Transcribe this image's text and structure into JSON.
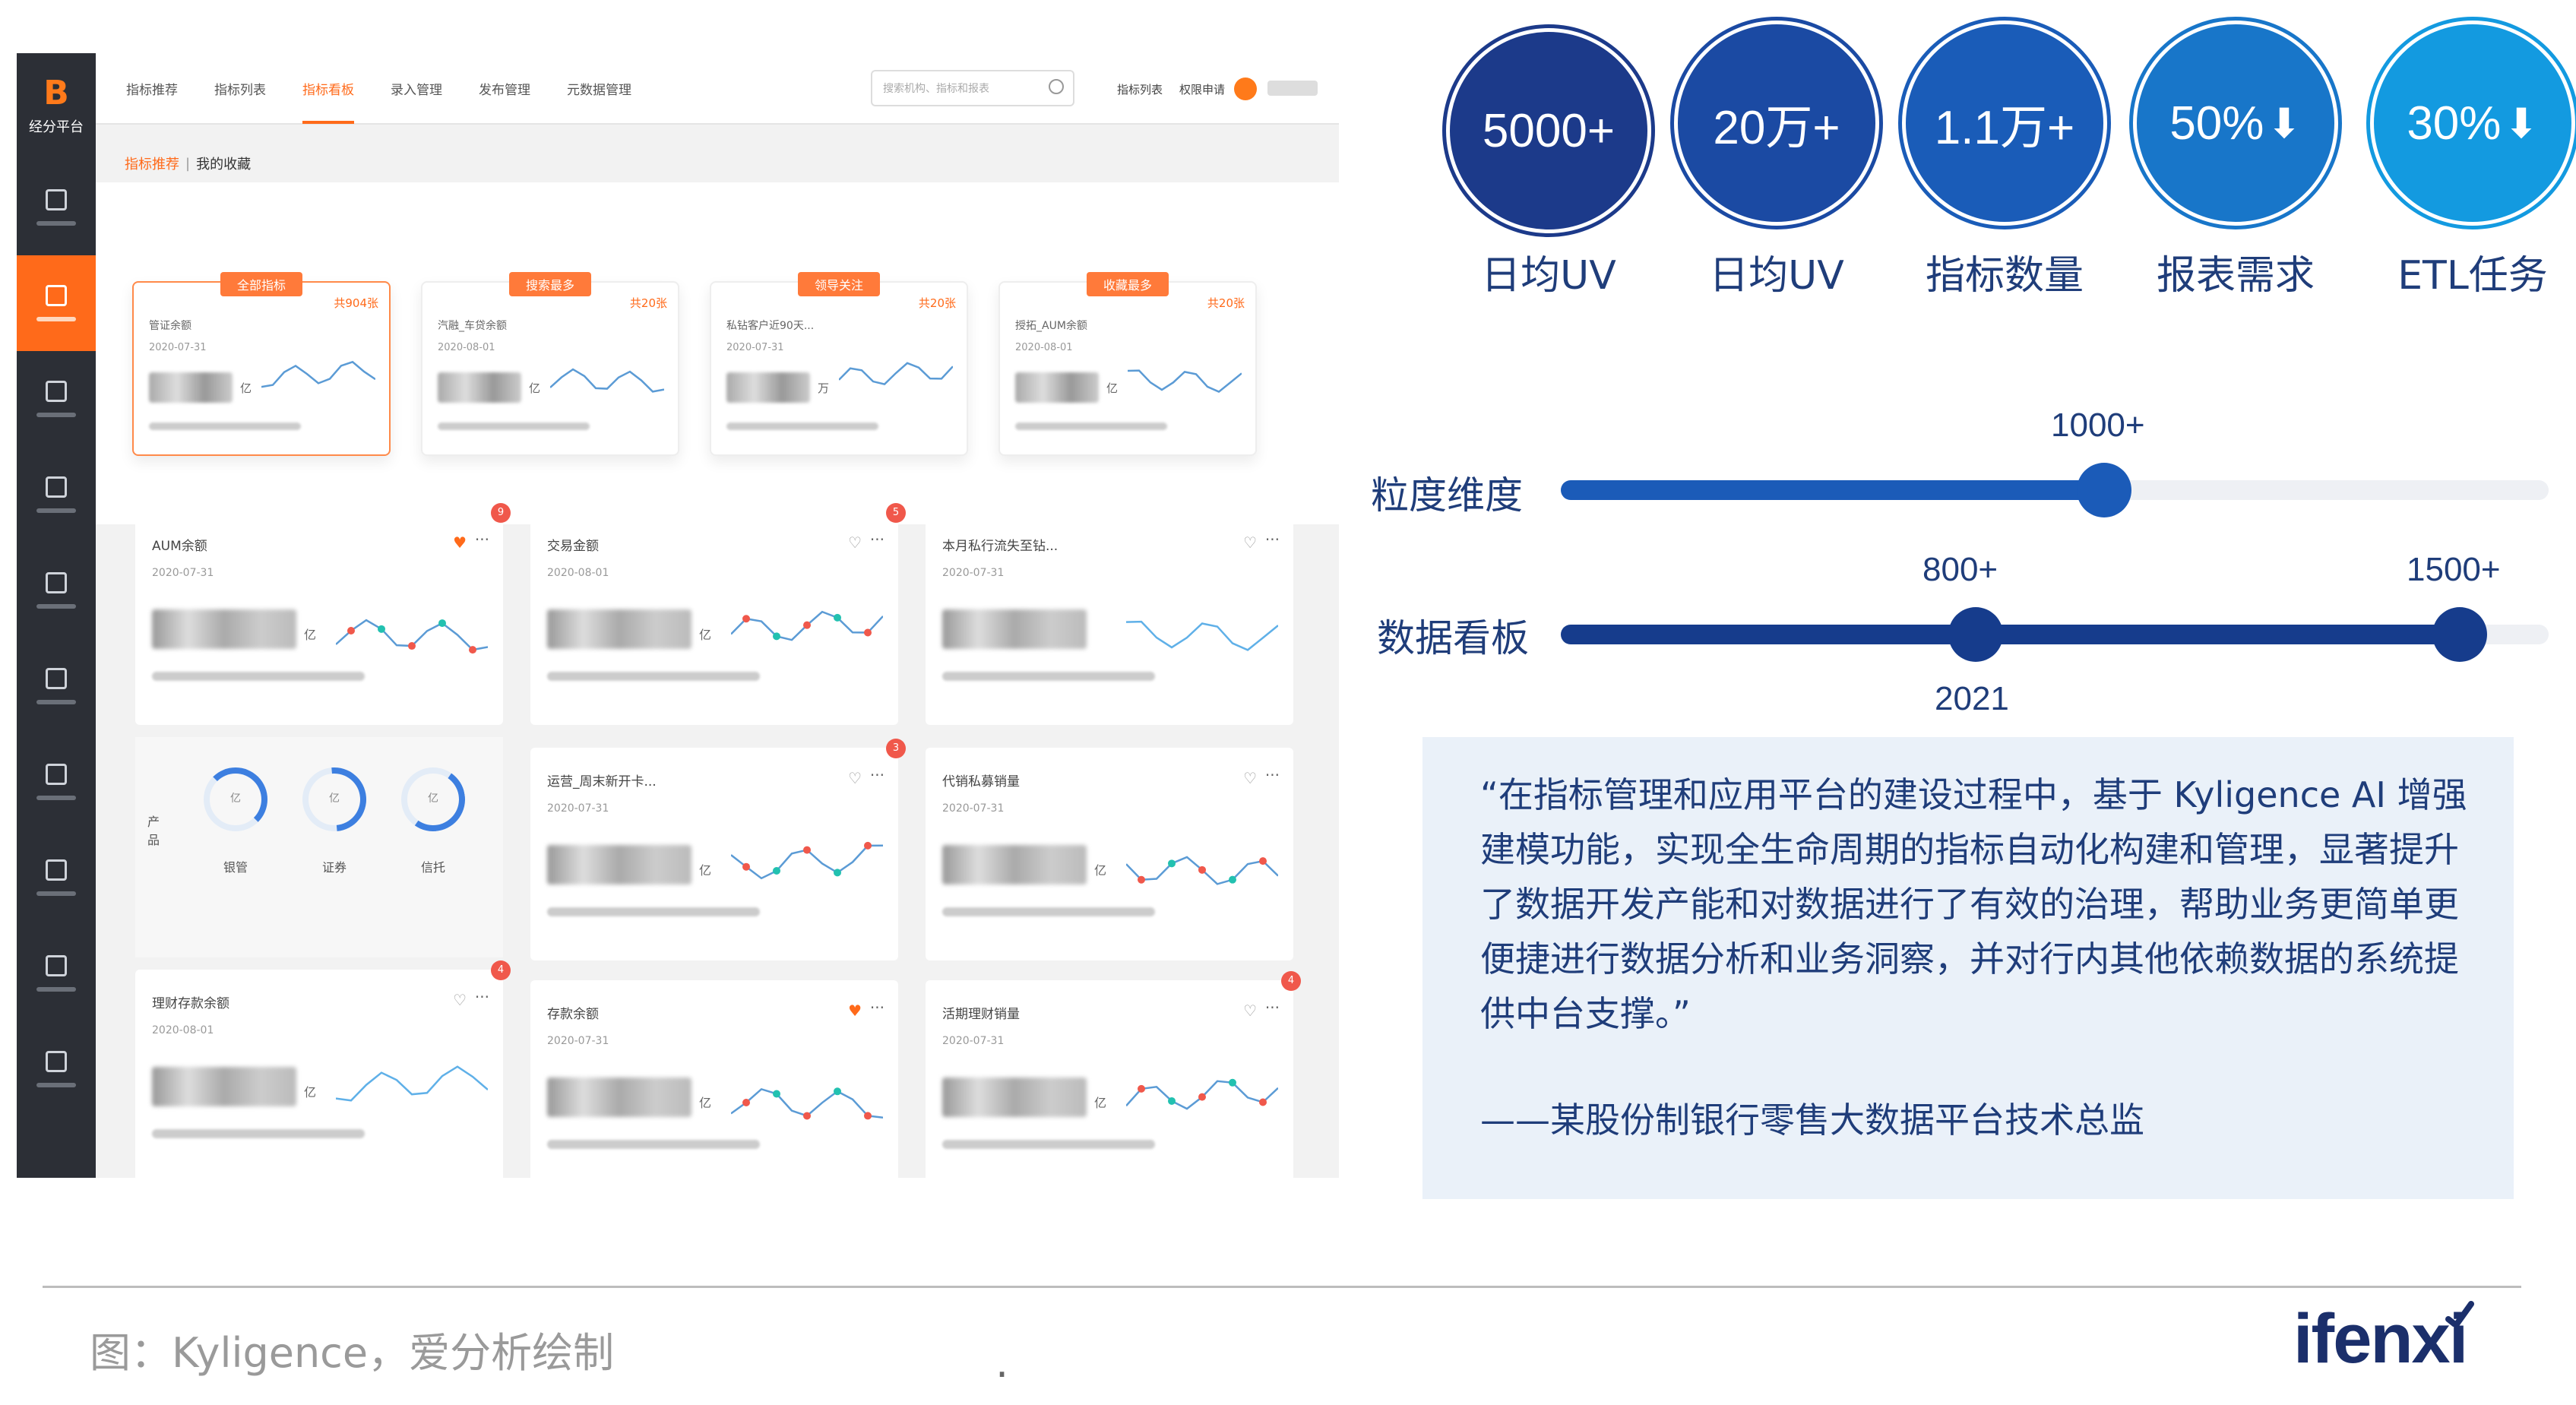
{
  "app": {
    "logo_mark": "B",
    "logo_name": "经分平台",
    "nav_tabs": [
      "指标推荐",
      "指标列表",
      "指标看板",
      "录入管理",
      "发布管理",
      "元数据管理"
    ],
    "active_tab": 2,
    "search_placeholder": "搜索机构、指标和报表",
    "top_links": [
      "指标列表",
      "权限申请"
    ],
    "breadcrumb": {
      "current": "指标推荐",
      "sep": "|",
      "fav": "我的收藏"
    },
    "hot_cards": [
      {
        "tag": "全部指标",
        "count": "共904张",
        "name": "管证余额",
        "date": "2020-07-31",
        "unit": "亿",
        "color": "#5b9bd5"
      },
      {
        "tag": "搜索最多",
        "count": "共20张",
        "name": "汽融_车贷余额",
        "date": "2020-08-01",
        "unit": "亿",
        "color": "#5b9bd5"
      },
      {
        "tag": "领导关注",
        "count": "共20张",
        "name": "私钻客户近90天...",
        "date": "2020-07-31",
        "unit": "万",
        "color": "#5b9bd5"
      },
      {
        "tag": "收藏最多",
        "count": "共20张",
        "name": "授拓_AUM余额",
        "date": "2020-08-01",
        "unit": "亿",
        "color": "#5b9bd5"
      }
    ],
    "grid_cards": [
      {
        "name": "AUM余额",
        "date": "2020-07-31",
        "unit": "亿",
        "badge": "9"
      },
      {
        "name": "交易金额",
        "date": "2020-08-01",
        "unit": "亿",
        "badge": "5"
      },
      {
        "name": "本月私行流失至钻...",
        "date": "2020-07-31",
        "unit": "",
        "badge": ""
      },
      {
        "name": "运营_周末新开卡...",
        "date": "2020-07-31",
        "unit": "亿",
        "badge": "3"
      },
      {
        "name": "代销私募销量",
        "date": "2020-07-31",
        "unit": "亿",
        "badge": ""
      },
      {
        "name": "理财存款余额",
        "date": "2020-08-01",
        "unit": "亿",
        "badge": "4"
      },
      {
        "name": "存款余额",
        "date": "2020-07-31",
        "unit": "亿",
        "badge": ""
      },
      {
        "name": "活期理财销量",
        "date": "2020-07-31",
        "unit": "亿",
        "badge": "4"
      }
    ],
    "product_label": "产品",
    "gauges": [
      {
        "label": "银管",
        "unit": "亿"
      },
      {
        "label": "证券",
        "unit": "亿"
      },
      {
        "label": "信托",
        "unit": "亿"
      }
    ]
  },
  "stats": [
    {
      "value": "5000+",
      "label": "日均UV",
      "fill": "#1c3a8a",
      "ring": "#1c3a8a"
    },
    {
      "value": "20万+",
      "label": "日均UV",
      "fill": "#1b4aa3",
      "ring": "#1b4aa3"
    },
    {
      "value": "1.1万+",
      "label": "指标数量",
      "fill": "#1a5cb8",
      "ring": "#1a5cb8"
    },
    {
      "value": "50%",
      "label": "报表需求",
      "fill": "#1876c9",
      "ring": "#1876c9",
      "arrow": "down"
    },
    {
      "value": "30%",
      "label": "ETL任务",
      "fill": "#139ae0",
      "ring": "#139ae0",
      "arrow": "down"
    }
  ],
  "sliders": [
    {
      "label": "粒度维度",
      "ticks": [
        {
          "text": "1000+",
          "pos": 0.55
        }
      ],
      "fill_to": 0.55,
      "color": "#1b5bb8"
    },
    {
      "label": "数据看板",
      "ticks": [
        {
          "text": "800+",
          "pos": 0.42
        },
        {
          "text": "1500+",
          "pos": 0.91
        }
      ],
      "fill_to": 0.91,
      "year": "2021",
      "color": "#163c8c"
    }
  ],
  "quote": {
    "text": "“在指标管理和应用平台的建设过程中，基于 Kyligence AI 增强建模功能，实现全生命周期的指标自动化构建和管理，显著提升了数据开发产能和对数据进行了有效的治理，帮助业务更简单更便捷进行数据分析和业务洞察，并对行内其他依赖数据的系统提供中台支撑。”",
    "sign": "——某股份制银行零售大数据平台技术总监"
  },
  "footer": {
    "source": "图：Kyligence，爱分析绘制",
    "dot": ".",
    "logo": "ifenxi"
  }
}
